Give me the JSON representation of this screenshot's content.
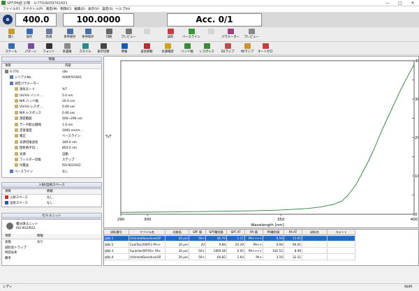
{
  "window": {
    "title": "SPF/PA値 計算 - V-770/A009761601",
    "min": "—",
    "max": "□",
    "close": "✕"
  },
  "menu": [
    "ファイル(F)",
    "スペクトル(P)",
    "測定(M)",
    "制御(C)",
    "編集(E)",
    "表示(V)",
    "設定(S)",
    "ヘルプ(H)"
  ],
  "readouts": {
    "wavelength": "400.0",
    "value": "100.0000",
    "acc": "Acc. 0/1"
  },
  "logo": "e",
  "toolbar1": [
    {
      "label": "開く",
      "icon": "folder-icon",
      "color": "#c99a3a",
      "disabled": false
    },
    {
      "label": "保存",
      "icon": "save-icon",
      "color": "#3a6ab0",
      "disabled": false
    },
    {
      "label": "新規",
      "icon": "new-icon",
      "color": "#6a7aa0",
      "disabled": false
    },
    {
      "label": "条件保存",
      "icon": "save-params-icon",
      "color": "#4a70a8",
      "disabled": false
    },
    {
      "label": "条件保存",
      "icon": "load-params-icon",
      "color": "#4a70a8",
      "disabled": false
    },
    {
      "label": "印刷",
      "icon": "print-icon",
      "color": "#666",
      "disabled": false
    },
    {
      "label": "プレビュー",
      "icon": "preview-icon",
      "color": "#777",
      "disabled": false
    },
    {
      "label": "",
      "icon": "disabled-icon",
      "color": "#bbb",
      "disabled": true
    },
    {
      "label": "試料",
      "icon": "sample-icon",
      "color": "#c04040",
      "disabled": false
    },
    {
      "label": "ベースライン",
      "icon": "baseline-icon",
      "color": "#3a9a3a",
      "disabled": false
    },
    {
      "label": "",
      "icon": "stop-icon",
      "color": "#bbb",
      "disabled": true
    },
    {
      "label": "パラメーター",
      "icon": "parameter-icon",
      "color": "#a04080",
      "disabled": false
    },
    {
      "label": "プレビュー",
      "icon": "preview2-icon",
      "color": "#888",
      "disabled": false
    }
  ],
  "toolbar2": [
    {
      "label": "スケール",
      "icon": "scale-icon",
      "color": "#3a6ab0"
    },
    {
      "label": "パターン",
      "icon": "pattern-icon",
      "color": "#7a4aa0"
    },
    {
      "label": "フォント",
      "icon": "font-icon",
      "color": "#333"
    },
    {
      "label": "目盛線",
      "icon": "grid-icon",
      "color": "#888"
    },
    {
      "label": "スタイル",
      "icon": "style-icon",
      "color": "#2a8a8a"
    },
    {
      "label": "表示切替",
      "icon": "toggle-view-icon",
      "color": "#444"
    },
    {
      "label": "情報",
      "icon": "info-icon",
      "color": "#1a5ab0"
    },
    {
      "label": "波長移動",
      "icon": "wavelength-move-icon",
      "color": "#b03030"
    },
    {
      "label": "光源確認",
      "icon": "light-source-icon",
      "color": "#d0a020"
    },
    {
      "label": "バンド幅",
      "icon": "bandwidth-icon",
      "color": "#3a8a3a"
    },
    {
      "label": "レスポンス",
      "icon": "response-icon",
      "color": "#3a8a3a"
    },
    {
      "label": "D2ランプ",
      "icon": "d2-lamp-icon",
      "color": "#b05050"
    },
    {
      "label": "WIランプ",
      "icon": "wi-lamp-icon",
      "color": "#d09030"
    },
    {
      "label": "オートゼロ",
      "icon": "auto-zero-icon",
      "color": "#c04040"
    }
  ],
  "info_panel": {
    "title": "情報",
    "col_item": "項目",
    "col_content": "内容",
    "rows": [
      {
        "k": "V-770",
        "v": "idle",
        "indent": 0
      },
      {
        "k": "シリアルNo.",
        "v": "A009761601",
        "indent": 1
      },
      {
        "k": "測定パラメーター",
        "v": "",
        "indent": 1
      },
      {
        "k": "測光モード",
        "v": "%T",
        "indent": 2
      },
      {
        "k": "UV/Vis バンド…",
        "v": "5.0 nm",
        "indent": 2
      },
      {
        "k": "NIR バンド幅",
        "v": "20.0 nm",
        "indent": 2
      },
      {
        "k": "UV/Vis レスポ…",
        "v": "0.06 sec",
        "indent": 2
      },
      {
        "k": "NIR レスポンス",
        "v": "0.06 sec",
        "indent": 2
      },
      {
        "k": "測定範囲",
        "v": "400~290 nm",
        "indent": 2
      },
      {
        "k": "データ取込間隔",
        "v": "1.0 nm",
        "indent": 2
      },
      {
        "k": "走査速度",
        "v": "1000 nm/m…",
        "indent": 2
      },
      {
        "k": "補正",
        "v": "ベースライン",
        "indent": 2
      },
      {
        "k": "光源切換波長",
        "v": "340.0 nm",
        "indent": 2
      },
      {
        "k": "回折格子切…",
        "v": "850.0 nm",
        "indent": 2
      },
      {
        "k": "光源",
        "v": "自動",
        "indent": 2
      },
      {
        "k": "フィルター切換",
        "v": "ステップ",
        "indent": 2
      },
      {
        "k": "付属品",
        "v": "ISV-922/922",
        "indent": 2
      },
      {
        "k": "ベースライン",
        "v": "なし",
        "indent": 1
      }
    ]
  },
  "io_panel": {
    "title": "入射/出射スペース",
    "col_item": "項目",
    "col_info": "情報",
    "rows": [
      {
        "k": "入射スペース",
        "v": "なし"
      },
      {
        "k": "出射スペース",
        "v": "なし"
      }
    ]
  },
  "cell_panel": {
    "title": "セルユニット",
    "unit_name": "積分球ユニット",
    "unit_model": "ISV-922/922",
    "col_item": "項目",
    "col_info": "情報",
    "rows": [
      {
        "k": "状態",
        "v": "あり"
      },
      {
        "k": "試料室トラップ",
        "v": ""
      },
      {
        "k": "判読光率",
        "v": ""
      },
      {
        "k": "備考",
        "v": ""
      }
    ]
  },
  "chart_data": {
    "type": "line",
    "xlabel": "Wavelength [nm]",
    "ylabel": "%T",
    "xlim": [
      290,
      400
    ],
    "ylim": [
      0,
      40
    ],
    "xticks": [
      290,
      300,
      350,
      400
    ],
    "yticks": [
      0,
      5,
      10,
      15,
      20,
      25,
      30,
      35,
      40
    ],
    "grid": false,
    "series": [
      {
        "color": "#2a7a3a",
        "x": [
          290,
          300,
          310,
          320,
          330,
          340,
          350,
          360,
          365,
          370,
          373,
          375,
          378,
          380,
          383,
          385,
          388,
          390,
          393,
          395,
          398,
          400
        ],
        "y": [
          0.5,
          0.55,
          0.6,
          0.7,
          0.8,
          0.9,
          1.1,
          1.5,
          1.9,
          2.6,
          3.5,
          4.8,
          7.5,
          10,
          14,
          17,
          22,
          25,
          29.5,
          32.5,
          36.5,
          39
        ]
      }
    ]
  },
  "table": {
    "headers": [
      "試料番号",
      "ファイル名",
      "光路長",
      "SPF 値",
      "SPF種別値",
      "SPF AT",
      "PA 値",
      "PA種別値",
      "PA AT",
      "試料名",
      "コメント"
    ],
    "rows": [
      [
        "試料-1",
        "UVshieldSensitive(SP",
        "20 μm",
        "50+",
        "85.70",
        "1.11",
        "PA++++",
        "8.59",
        "11.65",
        "",
        ""
      ],
      [
        "試料-2",
        "CoolTan20SPF2 PA+)",
        "20 μm",
        "20",
        "9.86",
        "25.29",
        "PA++",
        "0.94",
        "90.01",
        "",
        ""
      ],
      [
        "試料-3",
        "SunkillerSPF50+ PA+",
        "20 μm",
        "50+",
        "1859.38",
        "0.05",
        "PA++++",
        "181.52",
        "8.99",
        "",
        ""
      ],
      [
        "試料-4",
        "UVshieldSensitive(SP",
        "20 μm",
        "50+",
        "60.82",
        "1.64",
        "PA+",
        "3.10",
        "32.31",
        "",
        ""
      ]
    ]
  },
  "status": {
    "left": "レディ",
    "right": "NUM"
  }
}
